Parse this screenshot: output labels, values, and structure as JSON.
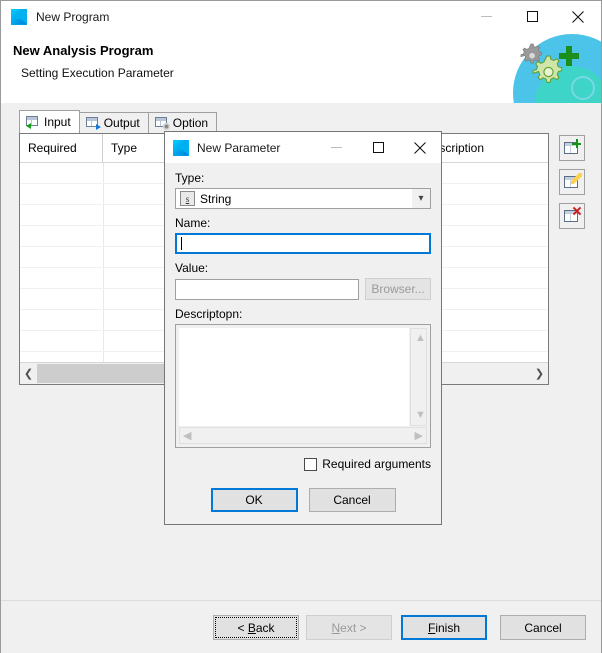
{
  "window": {
    "title": "New Program",
    "icon": "app-logo-icon",
    "controls": {
      "minimize": "minimize-icon",
      "maximize": "maximize-icon",
      "close": "close-icon",
      "minimize_disabled": true
    }
  },
  "header": {
    "title": "New Analysis Program",
    "subtitle": "Setting Execution Parameter",
    "art": "gears-plus-banner-graphic"
  },
  "tabs": [
    {
      "label": "Input",
      "icon": "grid-in-icon",
      "active": true
    },
    {
      "label": "Output",
      "icon": "grid-out-icon",
      "active": false
    },
    {
      "label": "Option",
      "icon": "grid-option-icon",
      "active": false
    }
  ],
  "grid": {
    "columns": [
      "Required",
      "Type",
      "",
      "",
      "Description"
    ],
    "row_count": 10,
    "scrollbar": {
      "left_arrow": "scroll-left-icon",
      "right_arrow": "scroll-right-icon",
      "thumb_percent": 70
    }
  },
  "toolbar": [
    {
      "name": "add-parameter-button",
      "icon": "grid-add-icon"
    },
    {
      "name": "edit-parameter-button",
      "icon": "grid-edit-icon"
    },
    {
      "name": "delete-parameter-button",
      "icon": "grid-delete-icon"
    }
  ],
  "footer": {
    "back": {
      "label": "< Back",
      "accel": "B",
      "disabled": false,
      "focused": true
    },
    "next": {
      "label": "Next >",
      "accel": "N",
      "disabled": true,
      "focused": false
    },
    "finish": {
      "label": "Finish",
      "accel": "F",
      "disabled": false,
      "default": true
    },
    "cancel": {
      "label": "Cancel",
      "accel": "",
      "disabled": false,
      "default": false
    }
  },
  "dialog": {
    "title": "New Parameter",
    "icon": "app-logo-icon",
    "controls": {
      "minimize": "minimize-icon",
      "maximize": "maximize-icon",
      "close": "close-icon",
      "minimize_disabled": true
    },
    "type": {
      "label": "Type:",
      "value": "String",
      "badge": "s",
      "chevron": "chevron-down-icon"
    },
    "name": {
      "label": "Name:",
      "value": "",
      "placeholder": ""
    },
    "value": {
      "label": "Value:",
      "value": "",
      "placeholder": "",
      "browse_label": "Browser...",
      "browse_disabled": true
    },
    "description": {
      "label": "Descriptopn:",
      "value": "",
      "scroll_up": "scroll-up-icon",
      "scroll_down": "scroll-down-icon",
      "scroll_left": "scroll-left-icon",
      "scroll_right": "scroll-right-icon"
    },
    "required_checkbox": {
      "label": "Required arguments",
      "checked": false
    },
    "ok": {
      "label": "OK",
      "default": true
    },
    "cancel": {
      "label": "Cancel",
      "default": false
    }
  },
  "colors": {
    "accent": "#0078d7",
    "window_bg": "#f0f0f0",
    "panel_bg": "#ffffff",
    "banner_cyan": "#4cc3e8",
    "banner_teal": "#3fd4c8",
    "gear_green": "#149414",
    "delete_red": "#cc2020"
  }
}
